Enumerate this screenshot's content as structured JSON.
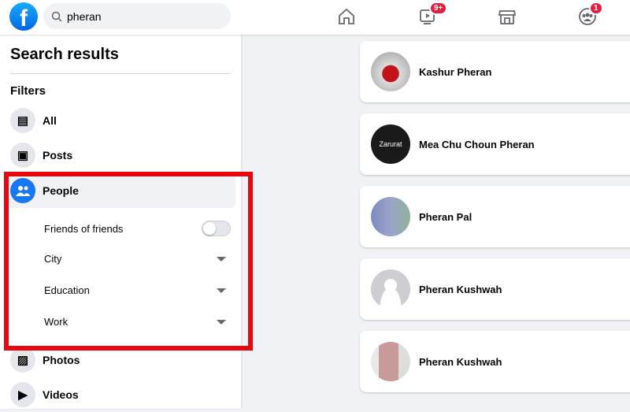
{
  "header": {
    "search_value": "pheran",
    "nav": [
      {
        "icon": "home-icon"
      },
      {
        "icon": "watch-icon",
        "badge": "9+"
      },
      {
        "icon": "marketplace-icon"
      },
      {
        "icon": "groups-icon",
        "badge": "1"
      }
    ]
  },
  "sidebar": {
    "title": "Search results",
    "filters_label": "Filters",
    "items": [
      {
        "label": "All",
        "icon": "all-icon"
      },
      {
        "label": "Posts",
        "icon": "posts-icon"
      },
      {
        "label": "People",
        "icon": "people-icon",
        "active": true
      },
      {
        "label": "Photos",
        "icon": "photos-icon"
      },
      {
        "label": "Videos",
        "icon": "videos-icon"
      }
    ],
    "people_filters": {
      "friends_of_friends": "Friends of friends",
      "friends_of_friends_on": false,
      "city": "City",
      "education": "Education",
      "work": "Work"
    }
  },
  "results": [
    {
      "name": "Kashur Pheran"
    },
    {
      "name": "Mea Chu Choun Pheran"
    },
    {
      "name": "Pheran Pal"
    },
    {
      "name": "Pheran Kushwah"
    },
    {
      "name": "Pheran Kushwah"
    }
  ],
  "colors": {
    "accent": "#1877f2",
    "highlight_box": "#e8070f",
    "badge": "#e41e3f"
  }
}
